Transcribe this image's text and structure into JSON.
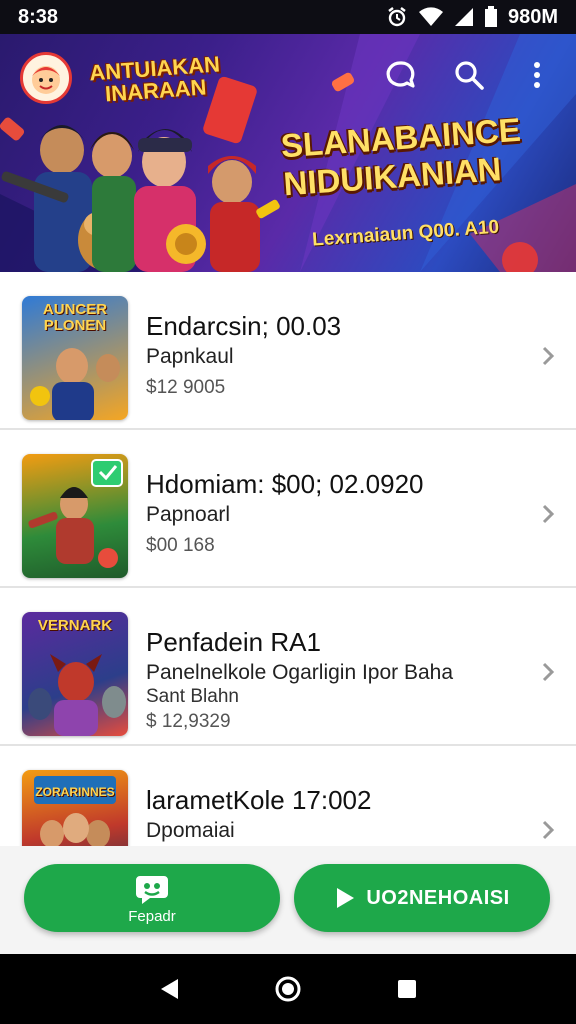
{
  "status_bar": {
    "time": "8:38",
    "battery_text": "980M"
  },
  "banner": {
    "small_title_line1": "ANTUIAKAN",
    "small_title_line2": "INARAAN",
    "title_line1": "SLANABAINCE",
    "title_line2": "NIDUIKANIAN",
    "subtitle": "Lexrnaiaun Q00. A10",
    "icons": [
      "chat-icon",
      "search-icon",
      "more-vert-icon"
    ]
  },
  "items": [
    {
      "thumb_title": "AUNCER PLONEN",
      "title": "Endarcsin; 00.03",
      "subtitle": "Papnkaul",
      "price": "$12 9005",
      "colors": [
        "#2f7ad6",
        "#f5a623"
      ]
    },
    {
      "thumb_title": "",
      "title": "Hdomiam: $00; 02.0920",
      "subtitle": "Papnoarl",
      "price": "$00 168",
      "colors": [
        "#2e8b3a",
        "#f39c12"
      ]
    },
    {
      "thumb_title": "VERNARK",
      "title": "Penfadein RA1",
      "subtitle": "Panelnelkole Ogarligin Ipor Baha",
      "price": "$ 12,9329",
      "extra": "Sant Blahn",
      "colors": [
        "#5b2a9e",
        "#e74c3c"
      ]
    },
    {
      "thumb_title": "ZORARINNES",
      "title": "larametKole 17:002",
      "subtitle": "Dpomaiai",
      "price": "",
      "colors": [
        "#c0392b",
        "#1f6fb8"
      ]
    }
  ],
  "actions": {
    "left_label": "Fepadr",
    "right_label": "UO2NEHOAISI",
    "accent": "#1ea84a"
  },
  "nav": {
    "icons": [
      "back-icon",
      "home-icon",
      "recents-icon"
    ]
  }
}
